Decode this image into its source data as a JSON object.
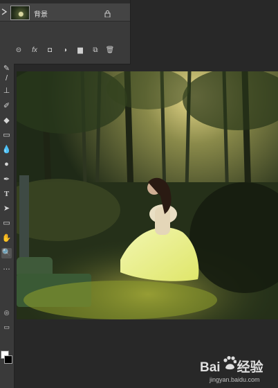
{
  "layers_panel": {
    "layer": {
      "name": "背景",
      "visibility_icon": "eye-icon",
      "lock_icon": "lock-icon"
    },
    "footer_buttons": [
      {
        "icon": "link-layers-icon",
        "glyph": "⊝"
      },
      {
        "icon": "fx-icon",
        "glyph": "fx"
      },
      {
        "icon": "layer-mask-icon",
        "glyph": "◘"
      },
      {
        "icon": "adjustment-layer-icon",
        "glyph": "◑"
      },
      {
        "icon": "group-folder-icon",
        "glyph": "▆"
      },
      {
        "icon": "new-layer-icon",
        "glyph": "⧉"
      },
      {
        "icon": "delete-layer-icon",
        "glyph": "🗑"
      }
    ]
  },
  "toolbar": {
    "tools": [
      {
        "icon": "mixer-brush-icon",
        "glyph": "✎"
      },
      {
        "icon": "brush-icon",
        "glyph": "/"
      },
      {
        "icon": "clone-stamp-icon",
        "glyph": "⊥"
      },
      {
        "icon": "history-brush-icon",
        "glyph": "✐"
      },
      {
        "icon": "eraser-icon",
        "glyph": "◆"
      },
      {
        "icon": "gradient-icon",
        "glyph": "▭"
      },
      {
        "icon": "blur-icon",
        "glyph": "💧"
      },
      {
        "icon": "dodge-icon",
        "glyph": "●"
      },
      {
        "icon": "pen-icon",
        "glyph": "✒"
      },
      {
        "icon": "type-icon",
        "glyph": "T"
      },
      {
        "icon": "path-selection-icon",
        "glyph": "➤"
      },
      {
        "icon": "rectangle-icon",
        "glyph": "▭"
      },
      {
        "icon": "hand-icon",
        "glyph": "✋"
      },
      {
        "icon": "zoom-icon",
        "glyph": "🔍"
      },
      {
        "icon": "more-tools-icon",
        "glyph": "…"
      }
    ],
    "active_tool": "zoom-icon",
    "foreground_color": "#ffffff",
    "background_color": "#000000"
  },
  "canvas": {
    "image": "forest-girl-photo"
  },
  "watermark": {
    "brand_left": "Bai",
    "brand_right": "经验",
    "url": "jingyan.baidu.com"
  }
}
